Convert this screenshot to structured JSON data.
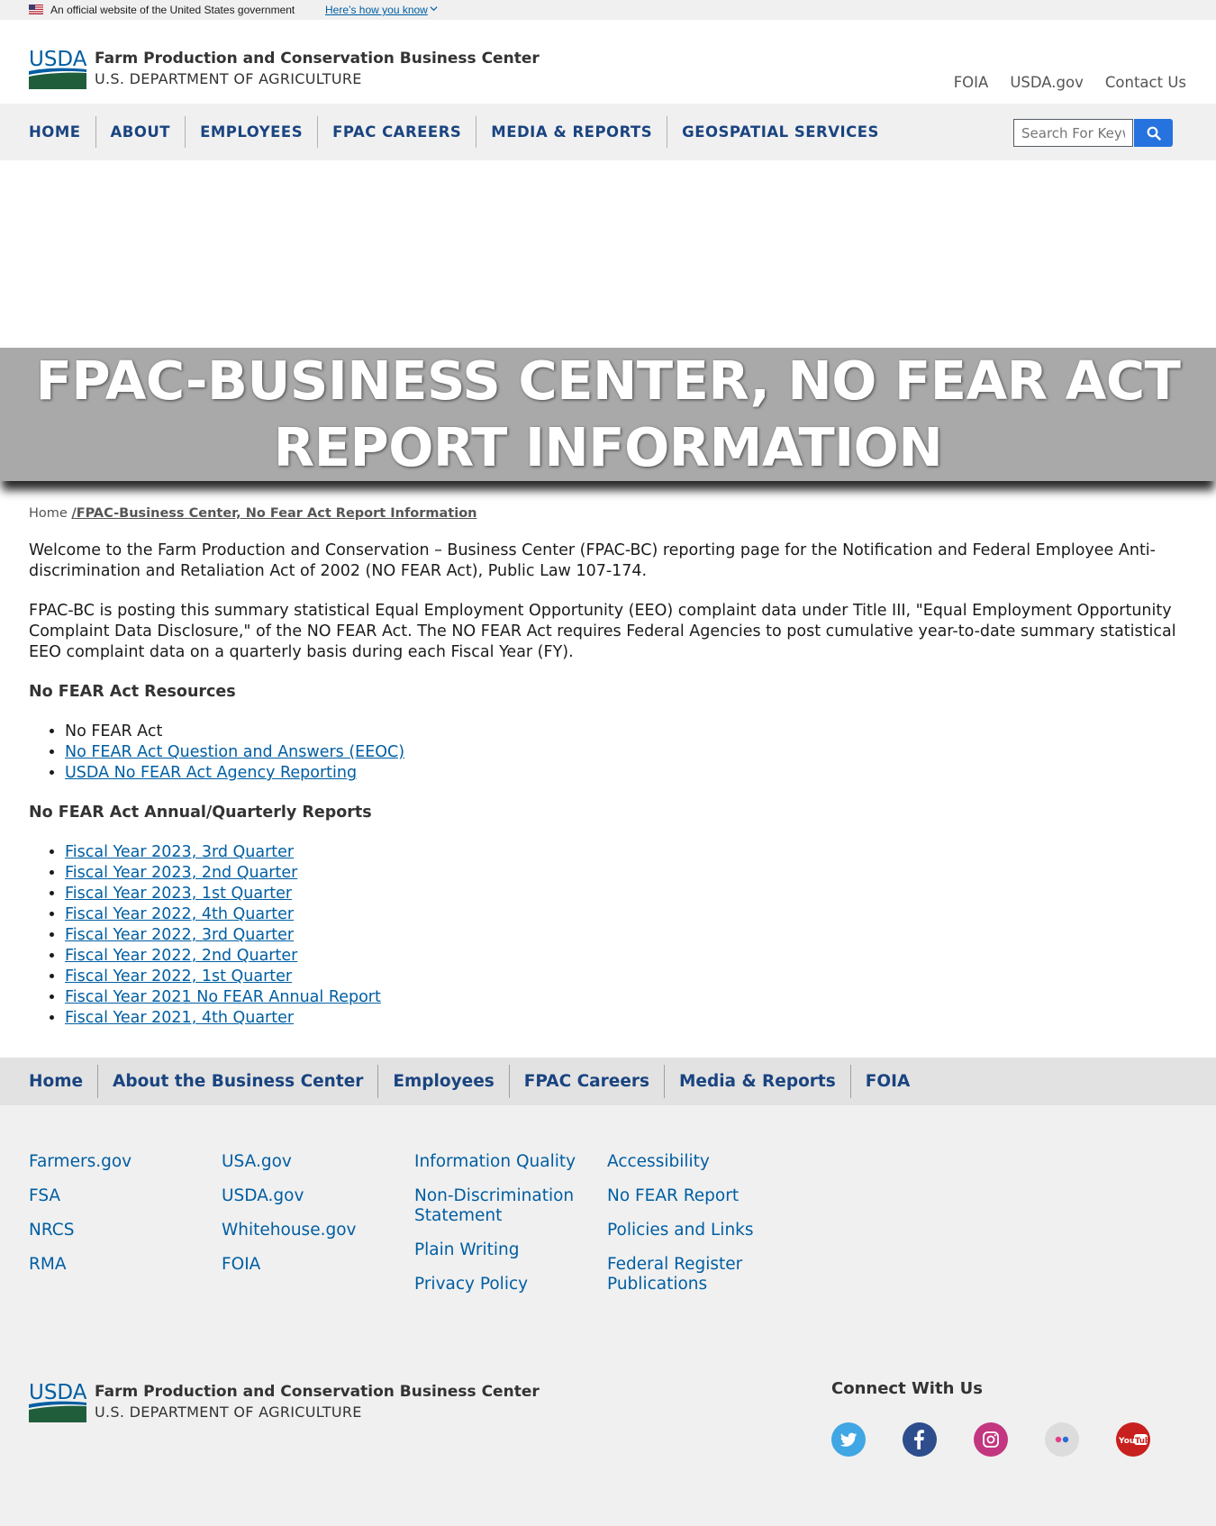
{
  "gov_banner": {
    "official_text": "An official website of the United States government",
    "how_you_know": "Here’s how you know"
  },
  "header": {
    "agency_name": "Farm Production and Conservation Business Center",
    "department": "U.S. DEPARTMENT OF AGRICULTURE",
    "util_links": [
      "FOIA",
      "USDA.gov",
      "Contact Us"
    ]
  },
  "nav": {
    "items": [
      "HOME",
      "ABOUT",
      "EMPLOYEES",
      "FPAC CAREERS",
      "MEDIA & REPORTS",
      "GEOSPATIAL SERVICES"
    ],
    "search_placeholder": "Search For Keywords"
  },
  "hero": {
    "title": "FPAC-BUSINESS CENTER, NO FEAR ACT REPORT INFORMATION"
  },
  "breadcrumb": {
    "home": "Home",
    "current": "/FPAC-Business Center, No Fear Act Report Information"
  },
  "content": {
    "intro": "Welcome to the Farm Production and Conservation – Business Center (FPAC-BC) reporting page for the Notification and Federal Employee Anti-discrimination and Retaliation Act of 2002 (NO FEAR Act), Public Law 107-174.",
    "summary": "FPAC-BC is posting this summary statistical Equal Employment Opportunity (EEO) complaint data under Title III, \"Equal Employment Opportunity Complaint Data Disclosure,\" of the NO FEAR Act. The NO FEAR Act requires Federal Agencies to post cumulative year-to-date summary statistical EEO complaint data on a quarterly basis during each Fiscal Year (FY).",
    "resources_heading": "No FEAR Act Resources",
    "resources": [
      "No FEAR Act",
      "No FEAR Act Question and Answers (EEOC)",
      "USDA No FEAR Act Agency Reporting"
    ],
    "reports_heading": "No FEAR Act Annual/Quarterly Reports",
    "reports": [
      "Fiscal Year 2023, 3rd Quarter",
      "Fiscal Year 2023, 2nd Quarter",
      "Fiscal Year 2023, 1st Quarter",
      "Fiscal Year 2022, 4th Quarter",
      "Fiscal Year 2022, 3rd Quarter",
      "Fiscal Year 2022, 2nd Quarter",
      "Fiscal Year 2022, 1st Quarter",
      "Fiscal Year 2021 No FEAR Annual Report",
      "Fiscal Year 2021, 4th Quarter"
    ]
  },
  "footer_nav": {
    "items": [
      "Home",
      "About the Business Center",
      "Employees",
      "FPAC Careers",
      "Media & Reports",
      "FOIA"
    ]
  },
  "footer": {
    "col1": [
      "Farmers.gov",
      "FSA",
      "NRCS",
      "RMA"
    ],
    "col2": [
      "USA.gov",
      "USDA.gov",
      "Whitehouse.gov",
      "FOIA"
    ],
    "col3": [
      "Information Quality",
      "Non-Discrimination Statement",
      "Plain Writing",
      "Privacy Policy"
    ],
    "col4": [
      "Accessibility",
      "No FEAR Report",
      "Policies and Links",
      "Federal Register Publications"
    ],
    "agency_name": "Farm Production and Conservation Business Center",
    "department": "U.S. DEPARTMENT OF AGRICULTURE",
    "connect_heading": "Connect With Us",
    "social_icons": [
      "twitter-icon",
      "facebook-icon",
      "instagram-icon",
      "flickr-icon",
      "youtube-icon"
    ]
  },
  "colors": {
    "nav_text": "#1a4480",
    "link": "#005ea2",
    "search_button": "#2672de",
    "hero_bg": "#a9a9a9",
    "usda_blue": "#005ea2",
    "usda_green": "#205e3b"
  }
}
